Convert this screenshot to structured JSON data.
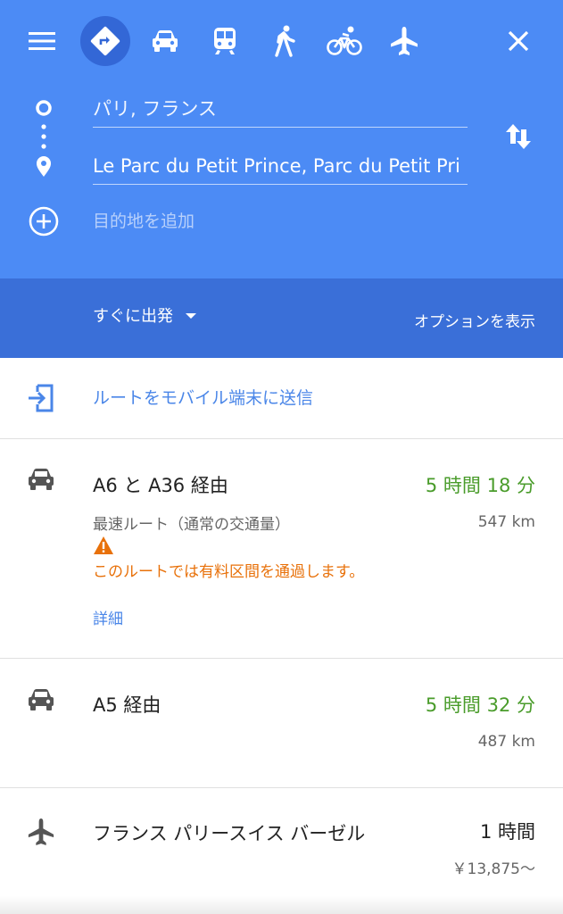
{
  "header": {
    "travel_modes": [
      {
        "icon": "directions-icon",
        "label": "Best route",
        "active": true
      },
      {
        "icon": "car-icon",
        "label": "Driving",
        "active": false
      },
      {
        "icon": "train-icon",
        "label": "Transit",
        "active": false
      },
      {
        "icon": "walk-icon",
        "label": "Walking",
        "active": false
      },
      {
        "icon": "bike-icon",
        "label": "Cycling",
        "active": false
      },
      {
        "icon": "plane-icon",
        "label": "Flights",
        "active": false
      }
    ],
    "origin_value": "パリ, フランス",
    "destination_value": "Le Parc du Petit Prince, Parc du Petit Pri",
    "add_destination_placeholder": "目的地を追加"
  },
  "subbar": {
    "depart_label": "すぐに出発",
    "options_label": "オプションを表示"
  },
  "send_to_device": {
    "label": "ルートをモバイル端末に送信"
  },
  "routes": [
    {
      "title": "A6 と A36 経由",
      "duration": "5 時間 18 分",
      "subtitle": "最速ルート（通常の交通量）",
      "distance": "547 km",
      "warning": "このルートでは有料区間を通過します。",
      "details_label": "詳細"
    },
    {
      "title": "A5 経由",
      "duration": "5 時間 32 分",
      "distance": "487 km"
    }
  ],
  "flight": {
    "title": "フランス パリースイス バーゼル",
    "duration": "1 時間",
    "price": "￥13,875〜"
  },
  "colors": {
    "header_bg": "#4c8bf5",
    "subbar_bg": "#3a6fd8",
    "active_mode_bg": "#3367d6",
    "duration_green": "#4a9c2b",
    "warning_orange": "#e8710a",
    "link_blue": "#4a86e8"
  }
}
